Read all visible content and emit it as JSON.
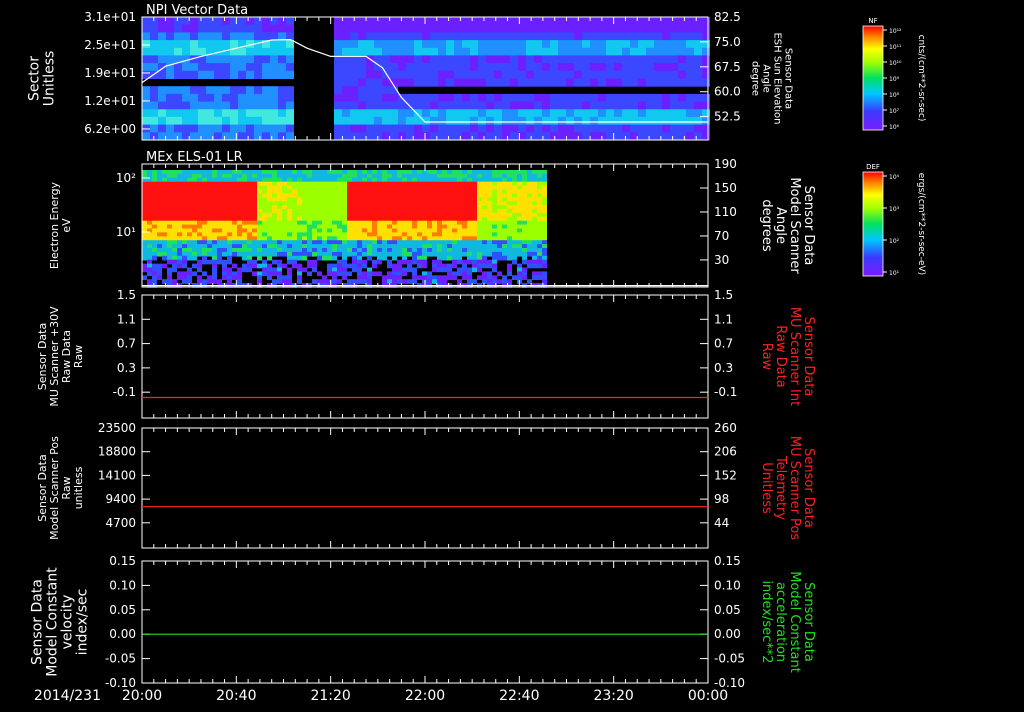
{
  "date_label": "2014/231",
  "time_ticks": [
    "20:00",
    "20:40",
    "21:20",
    "22:00",
    "22:40",
    "23:20",
    "00:00"
  ],
  "panels": [
    {
      "id": "npi",
      "title": "NPI Vector Data",
      "left_label": [
        "Sector",
        "Unitless"
      ],
      "left_label_color": "#ffffff",
      "right_label": [
        "Sensor Data",
        "ESH Sun Elevation",
        "Angle",
        "degree"
      ],
      "right_label_color": "#ffffff",
      "left_ticks": [
        "3.1e+01",
        "2.5e+01",
        "1.9e+01",
        "1.2e+01",
        "6.2e+00"
      ],
      "right_ticks": [
        "82.5",
        "75.0",
        "67.5",
        "60.0",
        "52.5"
      ],
      "colorbar": {
        "label": "NF",
        "units": "cnts/(cm**2-sr-sec)",
        "tick_labels": [
          "10¹²",
          "10¹¹",
          "10¹⁰",
          "10⁹",
          "10⁸",
          "10⁷",
          "10⁶"
        ]
      }
    },
    {
      "id": "els",
      "title": "MEx ELS-01 LR",
      "left_label": [
        "Electron Energy",
        "eV"
      ],
      "left_label_color": "#ffffff",
      "right_label": [
        "Sensor Data",
        "Model Scanner",
        "Angle",
        "degrees"
      ],
      "right_label_color": "#ffffff",
      "left_ticks": [
        "10²",
        "10¹"
      ],
      "right_ticks": [
        "190",
        "150",
        "110",
        "70",
        "30"
      ],
      "colorbar": {
        "label": "DEF",
        "units": "ergs/(cm**2-sr-sec-eV)",
        "tick_labels": [
          "10⁴",
          "10³",
          "10²",
          "10¹"
        ]
      }
    },
    {
      "id": "mu_int",
      "title": "",
      "left_label": [
        "Sensor Data",
        "MU Scanner +30V",
        "Raw Data",
        "Raw"
      ],
      "left_label_color": "#ffffff",
      "right_label": [
        "Sensor Data",
        "MU Scanner Int",
        "Raw Data",
        "Raw"
      ],
      "right_label_color": "#ff2020",
      "left_ticks": [
        "1.5",
        "1.1",
        "0.7",
        "0.3",
        "-0.1"
      ],
      "right_ticks": [
        "1.5",
        "1.1",
        "0.7",
        "0.3",
        "-0.1"
      ]
    },
    {
      "id": "mu_pos",
      "title": "",
      "left_label": [
        "Sensor Data",
        "Model Scanner Pos",
        "Raw",
        "unitless"
      ],
      "left_label_color": "#ffffff",
      "right_label": [
        "Sensor Data",
        "MU Scanner Pos",
        "Telemetry",
        "Unitless"
      ],
      "right_label_color": "#ff2020",
      "left_ticks": [
        "23500",
        "18800",
        "14100",
        "9400",
        "4700"
      ],
      "right_ticks": [
        "260",
        "206",
        "152",
        "98",
        "44"
      ]
    },
    {
      "id": "model_const",
      "title": "",
      "left_label": [
        "Sensor Data",
        "Model Constant",
        "velocity",
        "index/sec"
      ],
      "left_label_color": "#ffffff",
      "right_label": [
        "Sensor Data",
        "Model Constant",
        "acceleration",
        "index/sec**2"
      ],
      "right_label_color": "#20e020",
      "left_ticks": [
        "0.15",
        "0.10",
        "0.05",
        "0.00",
        "-0.05",
        "-0.10"
      ],
      "right_ticks": [
        "0.15",
        "0.10",
        "0.05",
        "0.00",
        "-0.05",
        "-0.10"
      ]
    }
  ],
  "chart_data": [
    {
      "panel": "npi",
      "type": "heatmap",
      "title": "NPI Vector Data",
      "x_range": [
        "20:00",
        "00:00"
      ],
      "ylim": [
        0,
        31
      ],
      "y2lim": [
        45,
        82.5
      ],
      "data_gap": [
        "21:06",
        "21:21"
      ],
      "series": [
        {
          "name": "ESH Sun Elevation Angle",
          "type": "line",
          "axis": "right",
          "color": "#ffffff",
          "x": [
            "20:00",
            "20:10",
            "20:25",
            "20:40",
            "20:55",
            "21:03",
            "21:10",
            "21:20",
            "21:35",
            "21:42",
            "21:50",
            "22:00",
            "23:00",
            "00:00"
          ],
          "y": [
            62.5,
            67.5,
            70.5,
            73.0,
            75.5,
            75.6,
            73.0,
            70.5,
            70.5,
            67.0,
            58.0,
            50.5,
            50.5,
            50.5
          ]
        }
      ]
    },
    {
      "panel": "els",
      "type": "heatmap",
      "title": "MEx ELS-01 LR",
      "x_range": [
        "20:00",
        "00:00"
      ],
      "y_scale": "log",
      "y_range_eV": [
        1,
        200
      ],
      "y2lim": [
        10,
        190
      ],
      "data_end": "22:50",
      "series": [
        {
          "name": "Model Scanner Angle",
          "type": "line",
          "axis": "right",
          "color": "#ffffff",
          "x": [
            "20:00",
            "00:00"
          ],
          "y": [
            12,
            12
          ]
        }
      ]
    },
    {
      "panel": "mu_int",
      "type": "line",
      "ylim": [
        -0.3,
        1.5
      ],
      "series": [
        {
          "name": "MU Scanner Int Raw Data",
          "color": "#ff2020",
          "x": [
            "20:00",
            "00:00"
          ],
          "y": [
            0.0,
            0.0
          ]
        }
      ]
    },
    {
      "panel": "mu_pos",
      "type": "line",
      "ylim": [
        0,
        23500
      ],
      "y2lim": [
        -10,
        260
      ],
      "series": [
        {
          "name": "MU Scanner Pos Telemetry",
          "axis": "right",
          "color": "#ff2020",
          "x": [
            "20:00",
            "00:00"
          ],
          "y": [
            83,
            83
          ]
        }
      ]
    },
    {
      "panel": "model_const",
      "type": "line",
      "ylim": [
        -0.1,
        0.15
      ],
      "series": [
        {
          "name": "Model Constant acceleration",
          "color": "#20e020",
          "x": [
            "20:00",
            "00:00"
          ],
          "y": [
            0.0,
            0.0
          ]
        }
      ]
    }
  ]
}
